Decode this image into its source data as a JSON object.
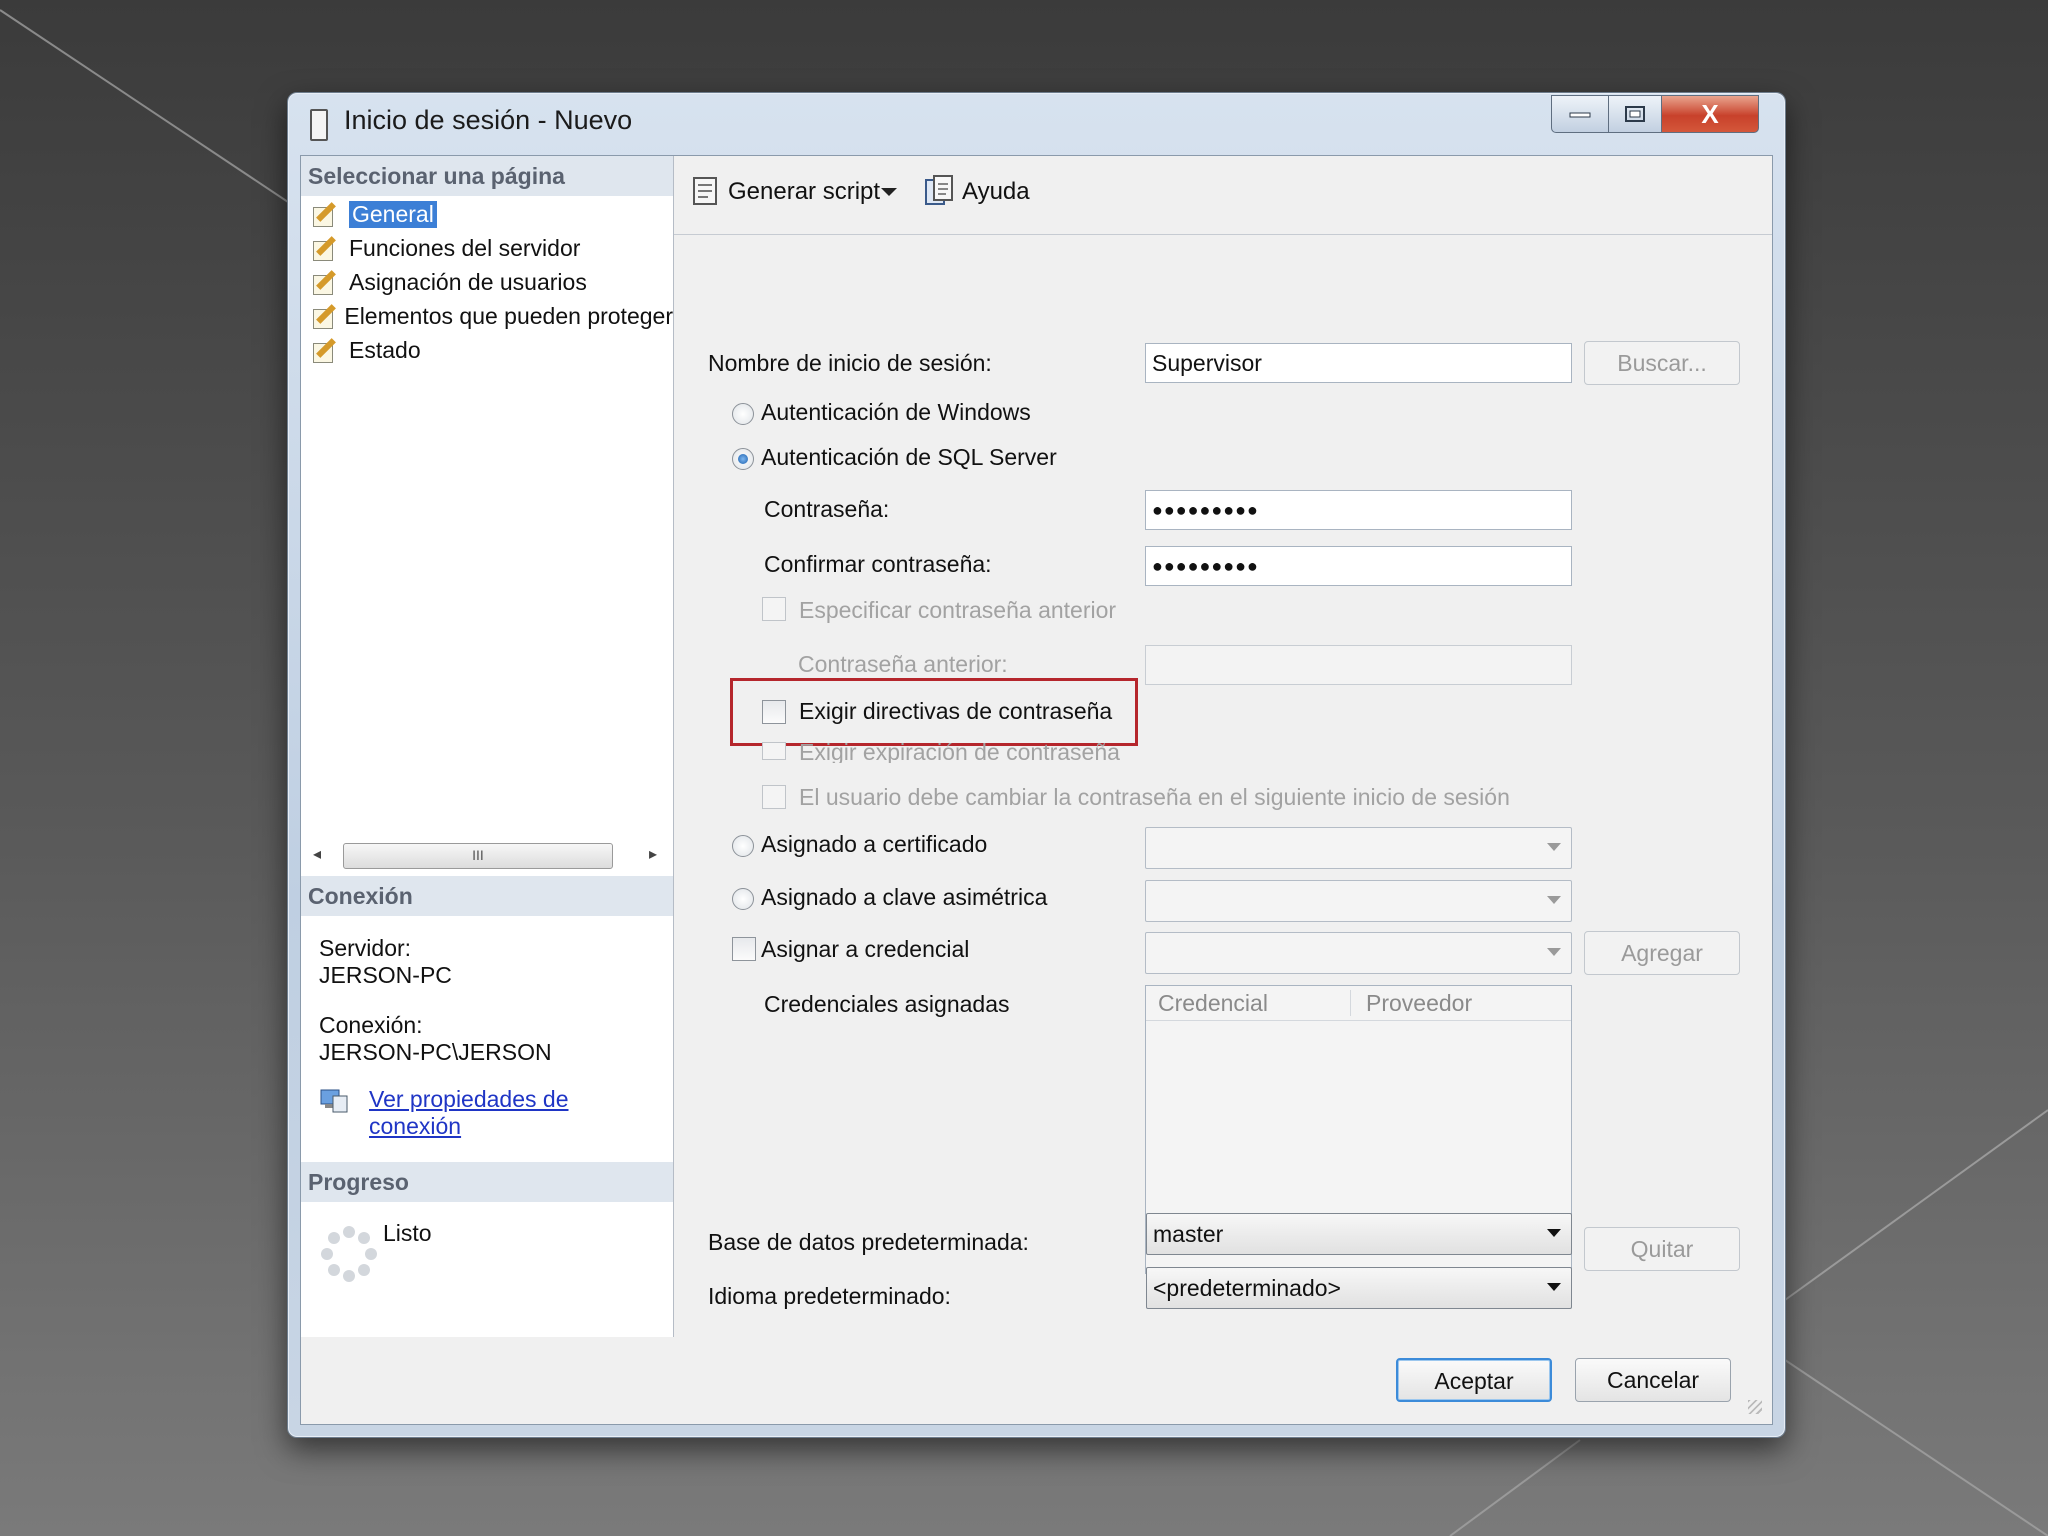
{
  "window": {
    "title": "Inicio de sesión - Nuevo",
    "close_glyph": "X"
  },
  "left_panel": {
    "select_page_header": "Seleccionar una página",
    "pages": [
      {
        "label": "General",
        "selected": true
      },
      {
        "label": "Funciones del servidor",
        "selected": false
      },
      {
        "label": "Asignación de usuarios",
        "selected": false
      },
      {
        "label": "Elementos que pueden proteger",
        "selected": false
      },
      {
        "label": "Estado",
        "selected": false
      }
    ],
    "scroll_grip": "III",
    "connection_header": "Conexión",
    "server_label": "Servidor:",
    "server_value": "JERSON-PC",
    "connection_label": "Conexión:",
    "connection_value": "JERSON-PC\\JERSON",
    "view_props_link_line1": "Ver propiedades de",
    "view_props_link_line2": "conexión",
    "progress_header": "Progreso",
    "progress_status": "Listo"
  },
  "toolbar": {
    "script_label": "Generar script",
    "help_label": "Ayuda"
  },
  "form": {
    "login_name_label": "Nombre de inicio de sesión:",
    "login_name_value": "Supervisor",
    "search_button": "Buscar...",
    "windows_auth_label": "Autenticación de Windows",
    "sql_auth_label": "Autenticación de SQL Server",
    "auth_mode": "sql",
    "password_label": "Contraseña:",
    "password_value": "●●●●●●●●●",
    "confirm_password_label": "Confirmar contraseña:",
    "confirm_password_value": "●●●●●●●●●",
    "specify_old_password_label": "Especificar contraseña anterior",
    "old_password_label": "Contraseña anterior:",
    "enforce_policy_label": "Exigir directivas de contraseña",
    "enforce_expiration_label": "Exigir expiración de contraseña",
    "must_change_label": "El usuario debe cambiar la contraseña en el siguiente inicio de sesión",
    "cert_label": "Asignado a certificado",
    "asym_key_label": "Asignado a clave asimétrica",
    "credential_label": "Asignar a credencial",
    "add_button": "Agregar",
    "assigned_credentials_label": "Credenciales asignadas",
    "grid_columns": [
      "Credencial",
      "Proveedor"
    ],
    "remove_button": "Quitar",
    "default_db_label": "Base de datos predeterminada:",
    "default_db_value": "master",
    "default_lang_label": "Idioma predeterminado:",
    "default_lang_value": "<predeterminado>"
  },
  "footer": {
    "ok_button": "Aceptar",
    "cancel_button": "Cancelar"
  },
  "colors": {
    "selection": "#3c7fd6",
    "highlight_border": "#b5262c",
    "link": "#1f35c5"
  }
}
